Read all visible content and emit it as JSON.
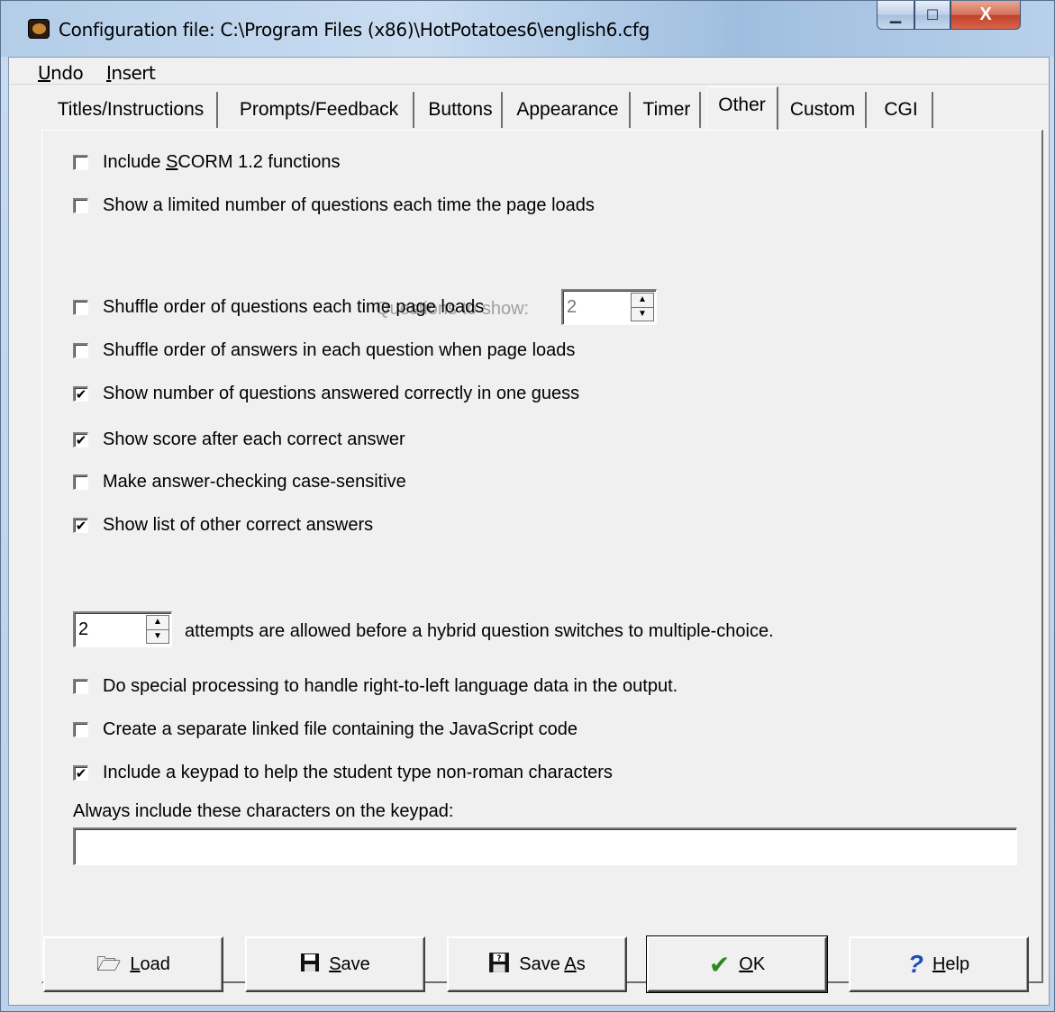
{
  "window": {
    "title": "Configuration file: C:\\Program Files (x86)\\HotPotatoes6\\english6.cfg",
    "controls": {
      "minimize": "▁",
      "maximize": "☐",
      "close": "X"
    }
  },
  "menu": {
    "undo": {
      "underline": "U",
      "rest": "ndo"
    },
    "insert": {
      "underline": "I",
      "rest": "nsert"
    }
  },
  "tabs": [
    {
      "label": "Titles/Instructions"
    },
    {
      "label": "Prompts/Feedback"
    },
    {
      "label": "Buttons"
    },
    {
      "label": "Appearance"
    },
    {
      "label": "Timer"
    },
    {
      "label": "Other",
      "active": true
    },
    {
      "label": "Custom"
    },
    {
      "label": "CGI"
    }
  ],
  "options": {
    "scorm": {
      "pre": "Include ",
      "ul": "S",
      "post": "CORM 1.2 functions",
      "checked": false
    },
    "limited": {
      "label": "Show a limited number of questions each time the page loads",
      "checked": false
    },
    "questions_to_show": {
      "label": "Questions to show:",
      "value": "2"
    },
    "shuffle_questions": {
      "label": "Shuffle order of questions each time page loads",
      "checked": false
    },
    "shuffle_answers": {
      "label": "Shuffle order of answers in each question when page loads",
      "checked": false
    },
    "show_correct_first": {
      "label": "Show number of questions answered correctly in one guess",
      "checked": true
    },
    "show_score": {
      "label": "Show score after each correct answer",
      "checked": true
    },
    "case_sensitive": {
      "label": "Make answer-checking case-sensitive",
      "checked": false
    },
    "other_answers": {
      "label": "Show list of other correct answers",
      "checked": true
    },
    "attempts": {
      "value": "2",
      "label": "attempts are allowed before a hybrid question switches to multiple-choice."
    },
    "rtl": {
      "label": "Do special processing to handle right-to-left language data in the output.",
      "checked": false
    },
    "separate_js": {
      "label": "Create a separate linked file containing the JavaScript code",
      "checked": false
    },
    "keypad": {
      "label": "Include a keypad to help the student type non-roman characters",
      "checked": true
    },
    "keypad_chars": {
      "label": "Always include these characters on the keypad:",
      "value": ""
    }
  },
  "check_glyph": "✔",
  "buttons": {
    "load": {
      "ul": "L",
      "rest": "oad",
      "icon": "folder-open-icon"
    },
    "save": {
      "ul": "S",
      "rest": "ave",
      "icon": "floppy-disk-icon"
    },
    "save_as": {
      "pre": "Save ",
      "ul": "A",
      "rest": "s",
      "icon": "floppy-disk-question-icon"
    },
    "ok": {
      "ul": "O",
      "rest": "K",
      "icon": "checkmark-icon"
    },
    "help": {
      "ul": "H",
      "rest": "elp",
      "icon": "question-mark-icon"
    }
  }
}
